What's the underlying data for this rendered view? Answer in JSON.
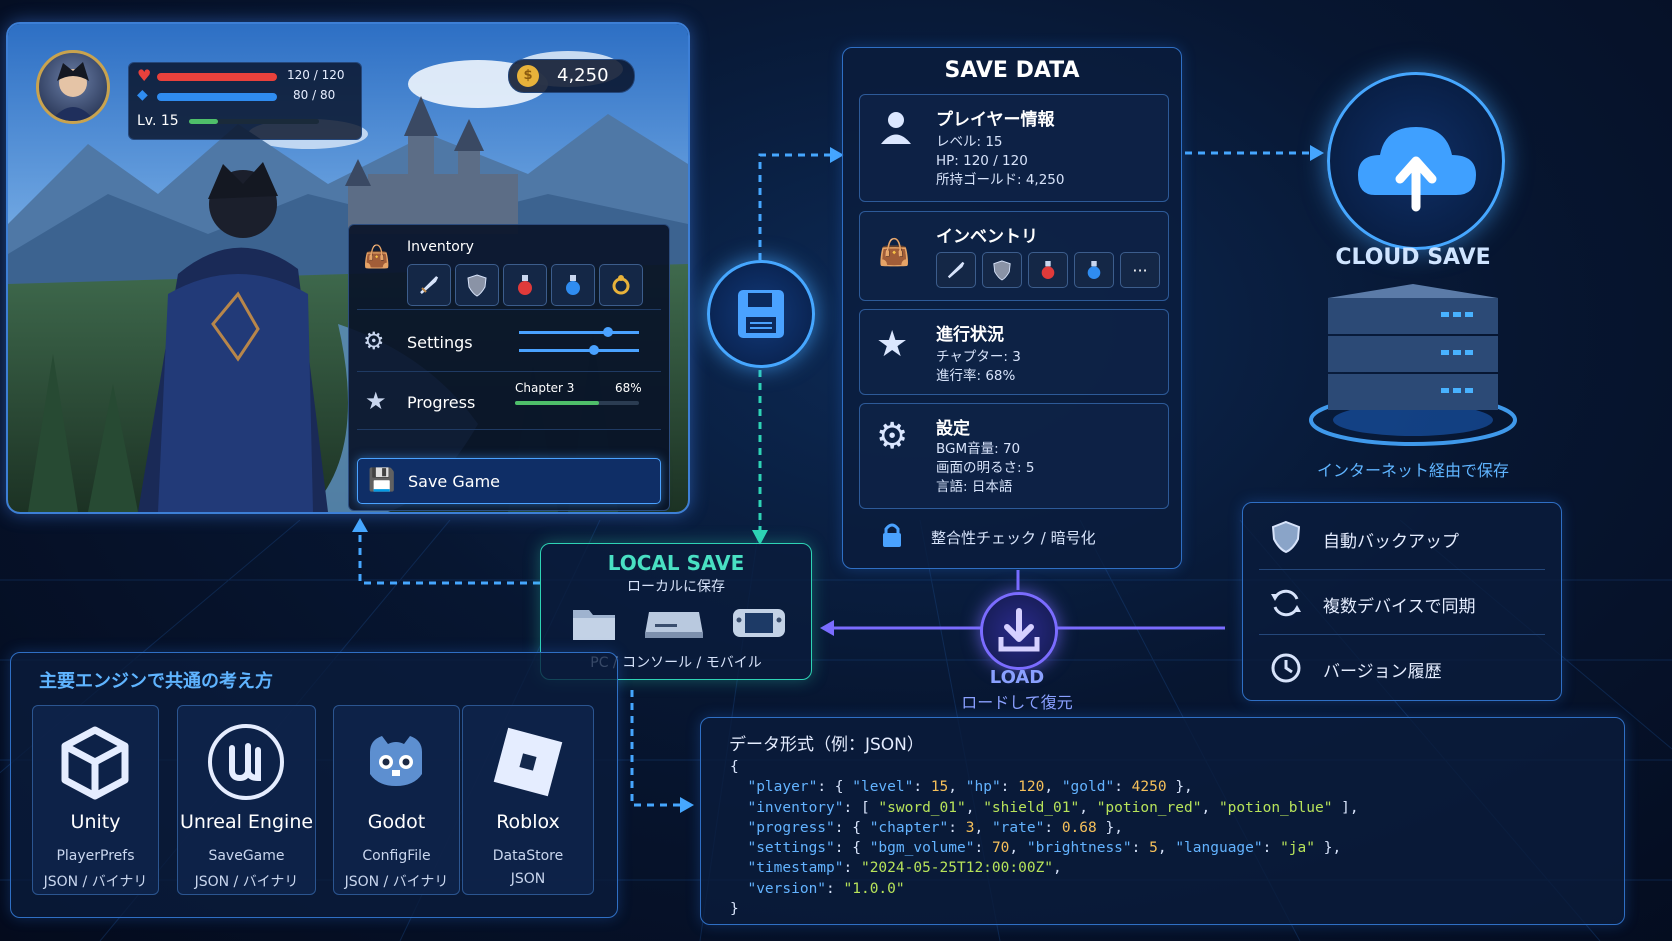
{
  "game": {
    "hp_text": "120 / 120",
    "mp_text": "80 / 80",
    "hp_ratio": 1.0,
    "mp_ratio": 1.0,
    "level_text": "Lv. 15",
    "level_progress": 0.22,
    "gold": "4,250",
    "menu": {
      "inventory_label": "Inventory",
      "settings_label": "Settings",
      "progress_label": "Progress",
      "chapter_label": "Chapter 3",
      "percent_label": "68%",
      "progress_value": 0.68,
      "save_label": "Save Game"
    },
    "inventory_items": [
      "sword-icon",
      "shield-icon",
      "red-potion-icon",
      "blue-potion-icon",
      "ring-icon"
    ]
  },
  "save_data": {
    "title": "SAVE DATA",
    "player": {
      "title": "プレイヤー情報",
      "lines": [
        "レベル: 15",
        "HP: 120 / 120",
        "所持ゴールド: 4,250"
      ]
    },
    "inventory": {
      "title": "インベントリ",
      "more": "···"
    },
    "progress": {
      "title": "進行状況",
      "lines": [
        "チャプター: 3",
        "進行率: 68%"
      ]
    },
    "settings": {
      "title": "設定",
      "lines": [
        "BGM音量: 70",
        "画面の明るさ: 5",
        "言語: 日本語"
      ]
    },
    "integrity": "整合性チェック / 暗号化"
  },
  "cloud": {
    "title": "CLOUD SAVE",
    "subtitle": "インターネット経由で保存"
  },
  "local": {
    "title": "LOCAL SAVE",
    "subtitle": "ローカルに保存",
    "devices": "PC / コンソール / モバイル"
  },
  "load": {
    "title": "LOAD",
    "subtitle": "ロードして復元"
  },
  "features": [
    "自動バックアップ",
    "複数デバイスで同期",
    "バージョン履歴"
  ],
  "engines": {
    "title": "主要エンジンで共通の考え方",
    "items": [
      {
        "name": "Unity",
        "api": "PlayerPrefs",
        "format": "JSON / バイナリ"
      },
      {
        "name": "Unreal Engine",
        "api": "SaveGame",
        "format": "JSON / バイナリ"
      },
      {
        "name": "Godot",
        "api": "ConfigFile",
        "format": "JSON / バイナリ"
      },
      {
        "name": "Roblox",
        "api": "DataStore",
        "format": "JSON"
      }
    ]
  },
  "json_example": {
    "title": "データ形式（例：JSON）",
    "open": "{",
    "close": "}",
    "player": {
      "level": 15,
      "hp": 120,
      "gold": 4250
    },
    "inventory": [
      "sword_01",
      "shield_01",
      "potion_red",
      "potion_blue"
    ],
    "progress": {
      "chapter": 3,
      "rate": 0.68
    },
    "settings": {
      "bgm_volume": 70,
      "brightness": 5,
      "language": "ja"
    },
    "timestamp": "2024-05-25T12:00:00Z",
    "version": "1.0.0"
  },
  "colors": {
    "accent": "#4aa2ff",
    "local": "#2ed3b5",
    "load": "#7b6cff",
    "hp": "#e8413c",
    "mp": "#2f8cf0",
    "xp": "#4fbf6a"
  }
}
